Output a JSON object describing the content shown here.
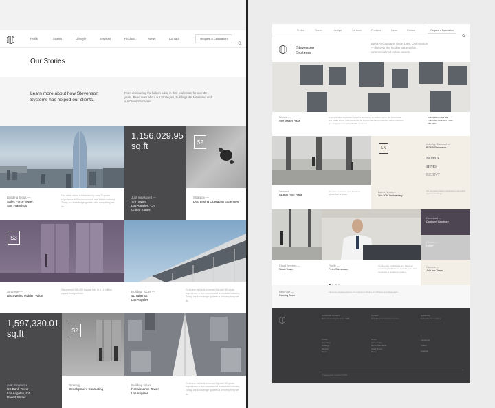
{
  "left": {
    "nav": {
      "items": [
        "Profile",
        "Stories",
        "Lifestyle",
        "Services",
        "Products",
        "News",
        "Contact"
      ],
      "cta": "Request a Calculation"
    },
    "page_title": "Our Stories",
    "intro": {
      "headline": "Learn more about how Stevenson Systems has helped our clients.",
      "body": "From discovering the hidden value in their real estate for over 30 years. Read more about our Strategies, Buildings We Measured and our Client Successes."
    },
    "big_area_1": {
      "value": "1,156,029.95",
      "unit": "sq.ft",
      "kicker": "Just measured —",
      "name": "777 Tower",
      "city": "Los Angeles, CA",
      "country": "United States"
    },
    "card_sf": {
      "kicker": "Building focus —",
      "name": "Sales Force Tower,",
      "city": "San Francisco",
      "body": "Our clear vision is informed by over 30 years experience in the commercial real estate industry. Today our knowledge guides us in everything we do."
    },
    "card_s2_a": {
      "badge": "S2",
      "kicker": "Strategy —",
      "name": "Decreasing Operating Expenses"
    },
    "card_s3": {
      "badge": "S3",
      "kicker": "Strategy —",
      "name": "Discovering Hidden Value",
      "body": "Discovered 345,000 square feet in a 12 million square foot portfolio."
    },
    "card_41": {
      "kicker": "Building focus —",
      "name": "41 Tahema,",
      "city": "Los Angeles",
      "body": "Our clear vision is informed by over 30 years experience in the commercial real estate industry. Today our knowledge guides us in everything we do."
    },
    "big_area_2": {
      "value": "1,597,330.01",
      "unit": "sq.ft",
      "kicker": "Just measured —",
      "name": "US Bank Tower",
      "city": "Los Angeles, CA",
      "country": "United States"
    },
    "card_s2_b": {
      "badge": "S2",
      "kicker": "Strategy —",
      "name": "Development Consulting"
    },
    "card_ren": {
      "kicker": "Building focus —",
      "name": "Renaissance Tower,",
      "city": "Los Angeles",
      "body": "Our clear vision is informed by over 30 years experience in the commercial real estate industry. Today our knowledge guides us in everything we do."
    }
  },
  "right": {
    "nav": {
      "items": [
        "Profile",
        "Stories",
        "Lifestyle",
        "Services",
        "Products",
        "News",
        "Contact"
      ],
      "cta": "Request a Calculation"
    },
    "brand": "Stevenson Systems",
    "tagline": "Boma Accountants since 1986. Our mission — discover the hidden value within commercial real estate assets.",
    "hero_caption": {
      "kicker": "Stories —",
      "name": "One Market Plaza",
      "body": "A story of what Stevenson Systems uncovered by experts within the commercial real estate sector, that resulted in the BOMA standards practices. These practices are designed around the BOMA standards.",
      "address": "One Market Plaza San Francisco, CA 94105 1-888-788-3477"
    },
    "c_asbuilt": {
      "kicker": "Services —",
      "name": "As-Built Floor Plans",
      "body": "We have measured over 45 million square feet of space."
    },
    "c_ln": {
      "badge": "LN",
      "kicker": "Latest News —",
      "name": "Our 30th Anniversary"
    },
    "c_boma": {
      "kicker": "Industry Standard —",
      "name": "BOMA Standards",
      "logos": [
        "BOMA",
        "IPMS",
        "REBNY"
      ],
      "body": "We use these industry standards to accurately measure buildings."
    },
    "c_brochure": {
      "kicker": "Download —",
      "name": "Company Brochure"
    },
    "c_home": {
      "kicker": "Clients —",
      "name": "Home"
    },
    "c_careers": {
      "kicker": "Careers —",
      "name": "Join our Team"
    },
    "c_stack": {
      "kicker": "Cloud Services —",
      "name": "Stack Tower"
    },
    "c_profile": {
      "kicker": "Profile —",
      "name": "Peter Stevenson",
      "body": "Our founder established and has been measuring buildings for over 30 years and continues to guide our mission."
    },
    "c_coming": {
      "kicker": "Land Use —",
      "name": "Coming Soon",
      "body": "Land use measurement is an upcoming service for planners and developers."
    },
    "footer": {
      "col1_head": "Stevenson Systems",
      "col1": "Boma Accountants since 1986",
      "col2_head": "Contact",
      "col2": "hello@stevensonsystems.com",
      "col3_head": "Newsletter",
      "col3": "Subscribe for updates",
      "links_a_head": "Profile",
      "links_a": [
        "Our Story",
        "Strategy",
        "Mission",
        "Team"
      ],
      "links_b_head": "News",
      "links_b": [
        "Anniversary",
        "Boma Standards",
        "Stack Tower",
        "Press"
      ],
      "links_c": [
        "Facebook",
        "Twitter",
        "Linkedin"
      ],
      "copyright": "© Stevenson Systems 2016"
    }
  }
}
